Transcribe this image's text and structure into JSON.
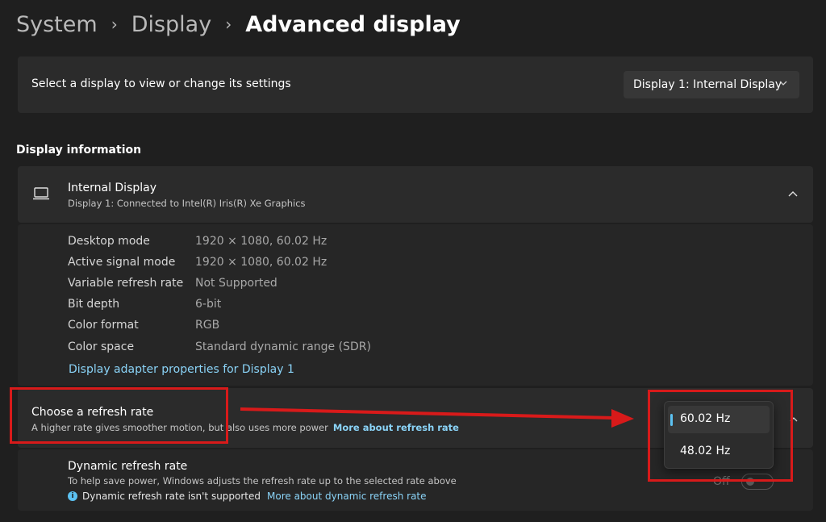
{
  "breadcrumb": {
    "items": [
      "System",
      "Display"
    ],
    "current": "Advanced display"
  },
  "display_selector": {
    "label": "Select a display to view or change its settings",
    "selected": "Display 1: Internal Display"
  },
  "display_information": {
    "section_title": "Display information",
    "device_name": "Internal Display",
    "device_subtitle": "Display 1: Connected to Intel(R) Iris(R) Xe Graphics",
    "rows": [
      {
        "label": "Desktop mode",
        "value": "1920 × 1080, 60.02 Hz"
      },
      {
        "label": "Active signal mode",
        "value": "1920 × 1080, 60.02 Hz"
      },
      {
        "label": "Variable refresh rate",
        "value": "Not Supported"
      },
      {
        "label": "Bit depth",
        "value": "6-bit"
      },
      {
        "label": "Color format",
        "value": "RGB"
      },
      {
        "label": "Color space",
        "value": "Standard dynamic range (SDR)"
      }
    ],
    "adapter_link": "Display adapter properties for Display 1"
  },
  "refresh_rate": {
    "title": "Choose a refresh rate",
    "description": "A higher rate gives smoother motion, but also uses more power",
    "link": "More about refresh rate",
    "options": [
      "60.02 Hz",
      "48.02 Hz"
    ],
    "selected": "60.02 Hz"
  },
  "dynamic_refresh": {
    "title": "Dynamic refresh rate",
    "description": "To help save power, Windows adjusts the refresh rate up to the selected rate above",
    "note": "Dynamic refresh rate isn't supported",
    "link": "More about dynamic refresh rate",
    "toggle_state": "Off"
  },
  "colors": {
    "background": "#1f1f1f",
    "card": "#2b2b2b",
    "accent": "#5cc2f2",
    "link": "#8ad3f7",
    "annotation": "#d81a1a"
  },
  "icons": {
    "breadcrumb_separator": "chevron-right-icon",
    "dropdown": "chevron-down-icon",
    "device": "laptop-icon",
    "collapse": "chevron-up-icon",
    "info": "info-icon"
  }
}
